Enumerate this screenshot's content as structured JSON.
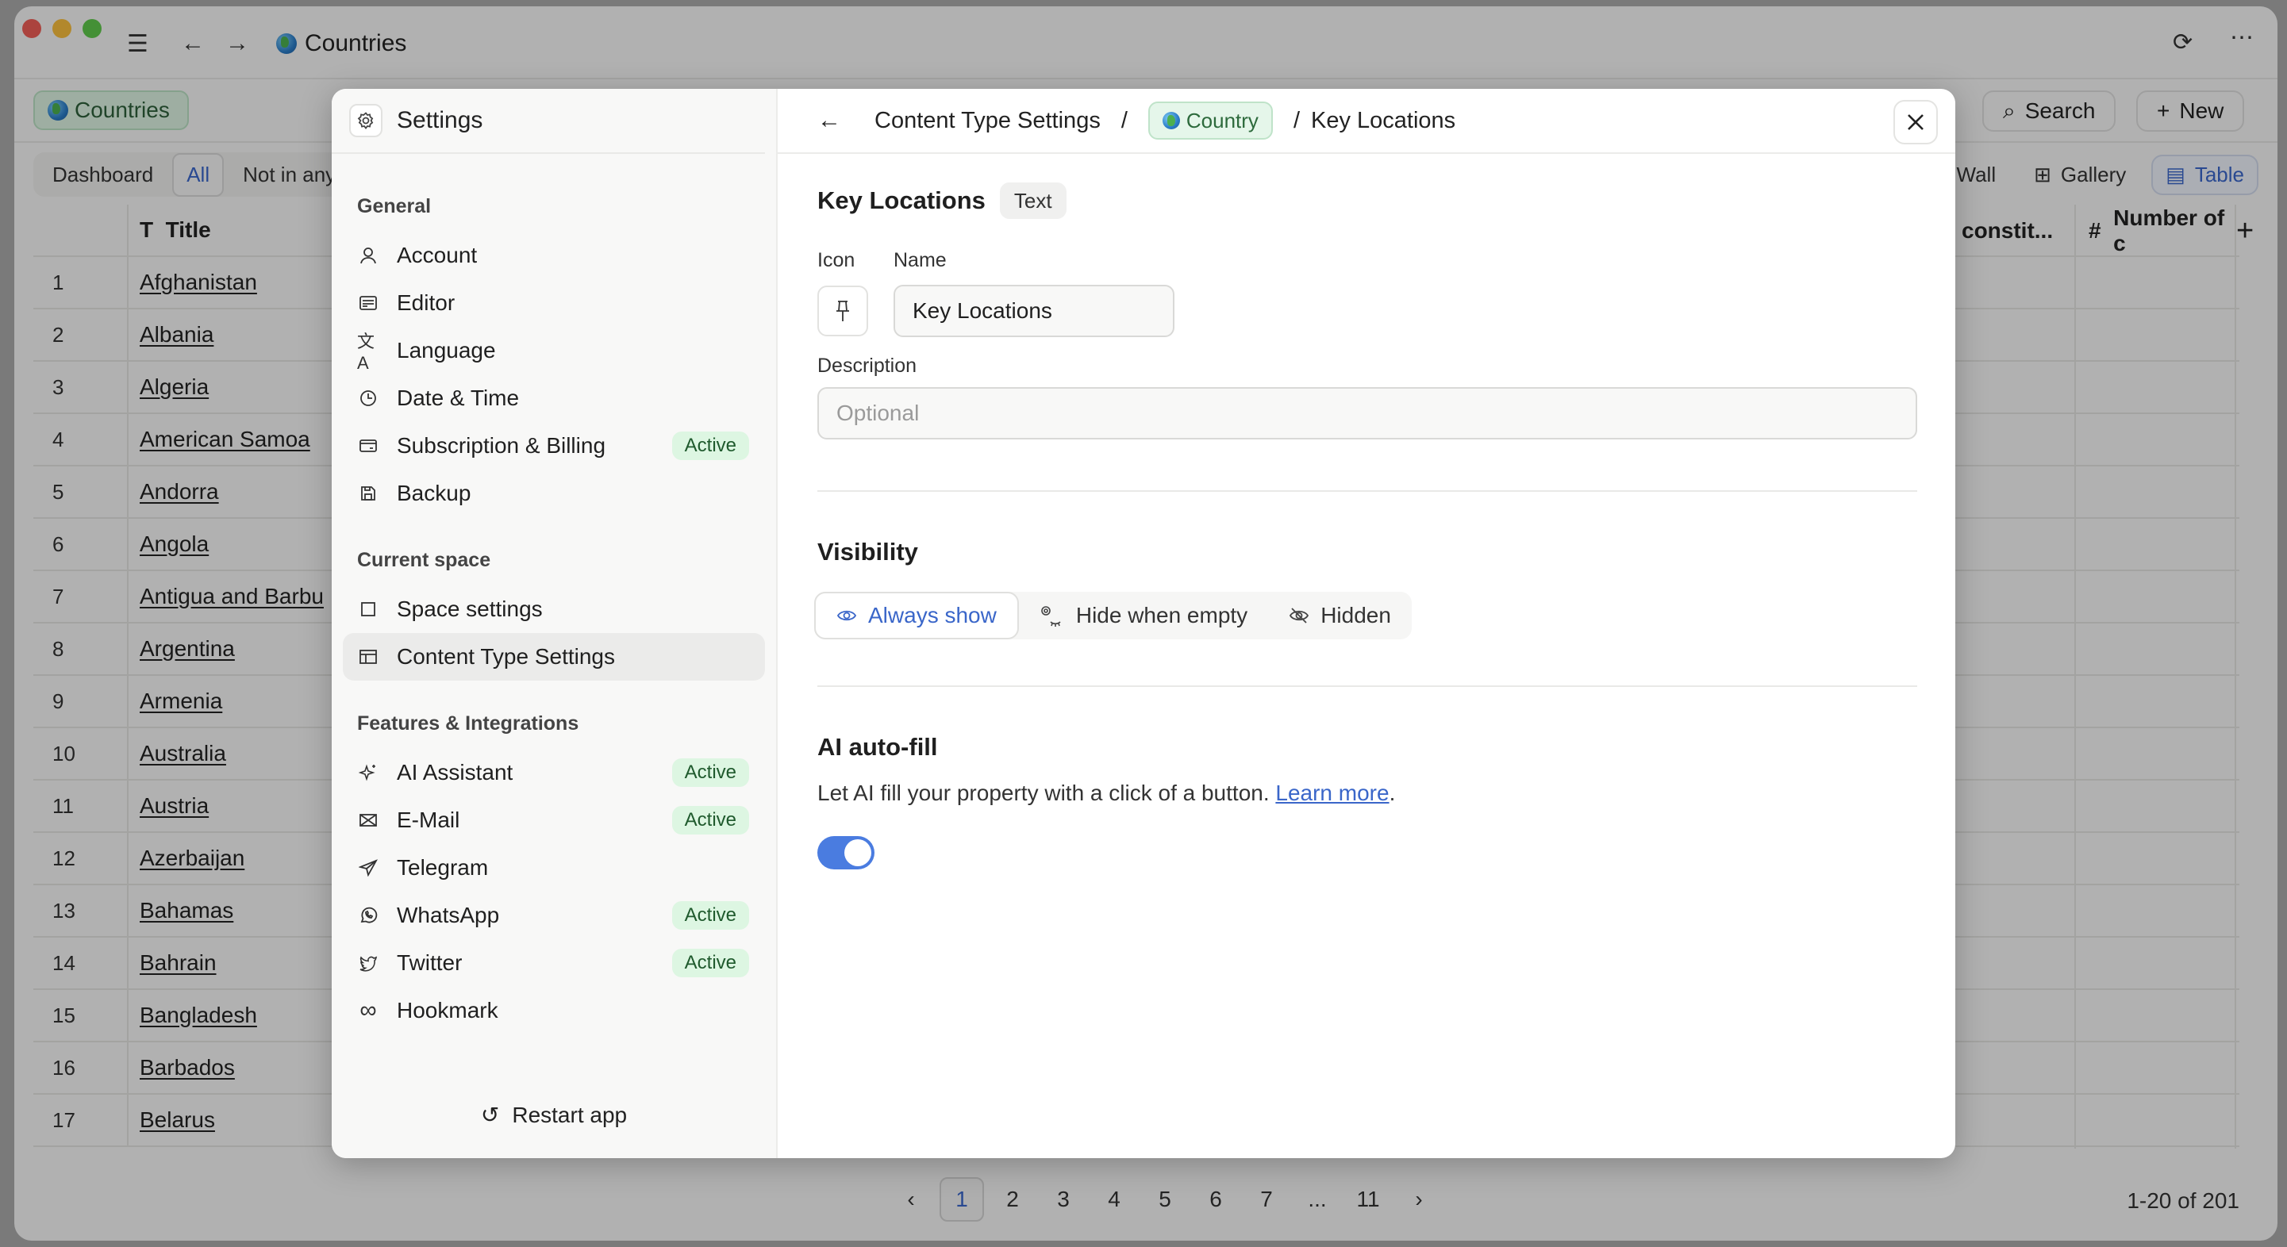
{
  "window": {
    "title": "Countries",
    "space_chip": "Countries",
    "search_label": "Search",
    "new_label": "New"
  },
  "view_tabs": [
    {
      "label": "Dashboard",
      "active": false
    },
    {
      "label": "All",
      "active": true
    },
    {
      "label": "Not in any",
      "active": false
    }
  ],
  "layout_tabs": [
    {
      "label": "Wall",
      "icon": "wall-icon",
      "active": false
    },
    {
      "label": "Gallery",
      "icon": "gallery-icon",
      "active": false
    },
    {
      "label": "Table",
      "icon": "table-icon",
      "active": true
    }
  ],
  "table": {
    "title_header": "Title",
    "right_headers": [
      "constit...",
      "Number of c"
    ],
    "rows": [
      {
        "num": "1",
        "title": "Afghanistan"
      },
      {
        "num": "2",
        "title": "Albania"
      },
      {
        "num": "3",
        "title": "Algeria"
      },
      {
        "num": "4",
        "title": "American Samoa"
      },
      {
        "num": "5",
        "title": "Andorra"
      },
      {
        "num": "6",
        "title": "Angola"
      },
      {
        "num": "7",
        "title": "Antigua and Barbu"
      },
      {
        "num": "8",
        "title": "Argentina"
      },
      {
        "num": "9",
        "title": "Armenia"
      },
      {
        "num": "10",
        "title": "Australia"
      },
      {
        "num": "11",
        "title": "Austria"
      },
      {
        "num": "12",
        "title": "Azerbaijan"
      },
      {
        "num": "13",
        "title": "Bahamas"
      },
      {
        "num": "14",
        "title": "Bahrain"
      },
      {
        "num": "15",
        "title": "Bangladesh"
      },
      {
        "num": "16",
        "title": "Barbados"
      },
      {
        "num": "17",
        "title": "Belarus"
      }
    ]
  },
  "pagination": {
    "pages": [
      "1",
      "2",
      "3",
      "4",
      "5",
      "6",
      "7",
      "...",
      "11"
    ],
    "current": "1",
    "count_text": "1-20 of 201"
  },
  "settings": {
    "title": "Settings",
    "groups": [
      {
        "label": "General",
        "items": [
          {
            "label": "Account",
            "icon": "user-icon",
            "badge": null
          },
          {
            "label": "Editor",
            "icon": "editor-icon",
            "badge": null
          },
          {
            "label": "Language",
            "icon": "translate-icon",
            "badge": null
          },
          {
            "label": "Date & Time",
            "icon": "clock-icon",
            "badge": null
          },
          {
            "label": "Subscription & Billing",
            "icon": "credit-card-icon",
            "badge": "Active"
          },
          {
            "label": "Backup",
            "icon": "save-icon",
            "badge": null
          }
        ]
      },
      {
        "label": "Current space",
        "items": [
          {
            "label": "Space settings",
            "icon": "square-icon",
            "badge": null
          },
          {
            "label": "Content Type Settings",
            "icon": "layout-icon",
            "badge": null,
            "selected": true
          }
        ]
      },
      {
        "label": "Features & Integrations",
        "items": [
          {
            "label": "AI Assistant",
            "icon": "sparkle-icon",
            "badge": "Active"
          },
          {
            "label": "E-Mail",
            "icon": "mail-icon",
            "badge": "Active"
          },
          {
            "label": "Telegram",
            "icon": "send-icon",
            "badge": null
          },
          {
            "label": "WhatsApp",
            "icon": "whatsapp-icon",
            "badge": "Active"
          },
          {
            "label": "Twitter",
            "icon": "twitter-icon",
            "badge": "Active"
          },
          {
            "label": "Hookmark",
            "icon": "infinity-icon",
            "badge": null
          }
        ]
      }
    ],
    "restart_label": "Restart app"
  },
  "detail": {
    "breadcrumb": {
      "root": "Content Type Settings",
      "chip": "Country",
      "leaf": "Key Locations",
      "separator": "/"
    },
    "property_name": "Key Locations",
    "property_type": "Text",
    "icon_label": "Icon",
    "name_label": "Name",
    "name_value": "Key Locations",
    "description_label": "Description",
    "description_placeholder": "Optional",
    "description_value": "",
    "visibility": {
      "title": "Visibility",
      "options": [
        {
          "label": "Always show",
          "active": true
        },
        {
          "label": "Hide when empty",
          "active": false
        },
        {
          "label": "Hidden",
          "active": false
        }
      ]
    },
    "ai_autofill": {
      "title": "AI auto-fill",
      "description": "Let AI fill your property with a click of a button. ",
      "link_text": "Learn more",
      "trailing": ".",
      "enabled": true
    }
  },
  "colors": {
    "accent": "#3a66c9",
    "toggle_on": "#4a7ce0",
    "badge_bg": "#ddf6e2",
    "badge_text": "#1f5a2d"
  }
}
